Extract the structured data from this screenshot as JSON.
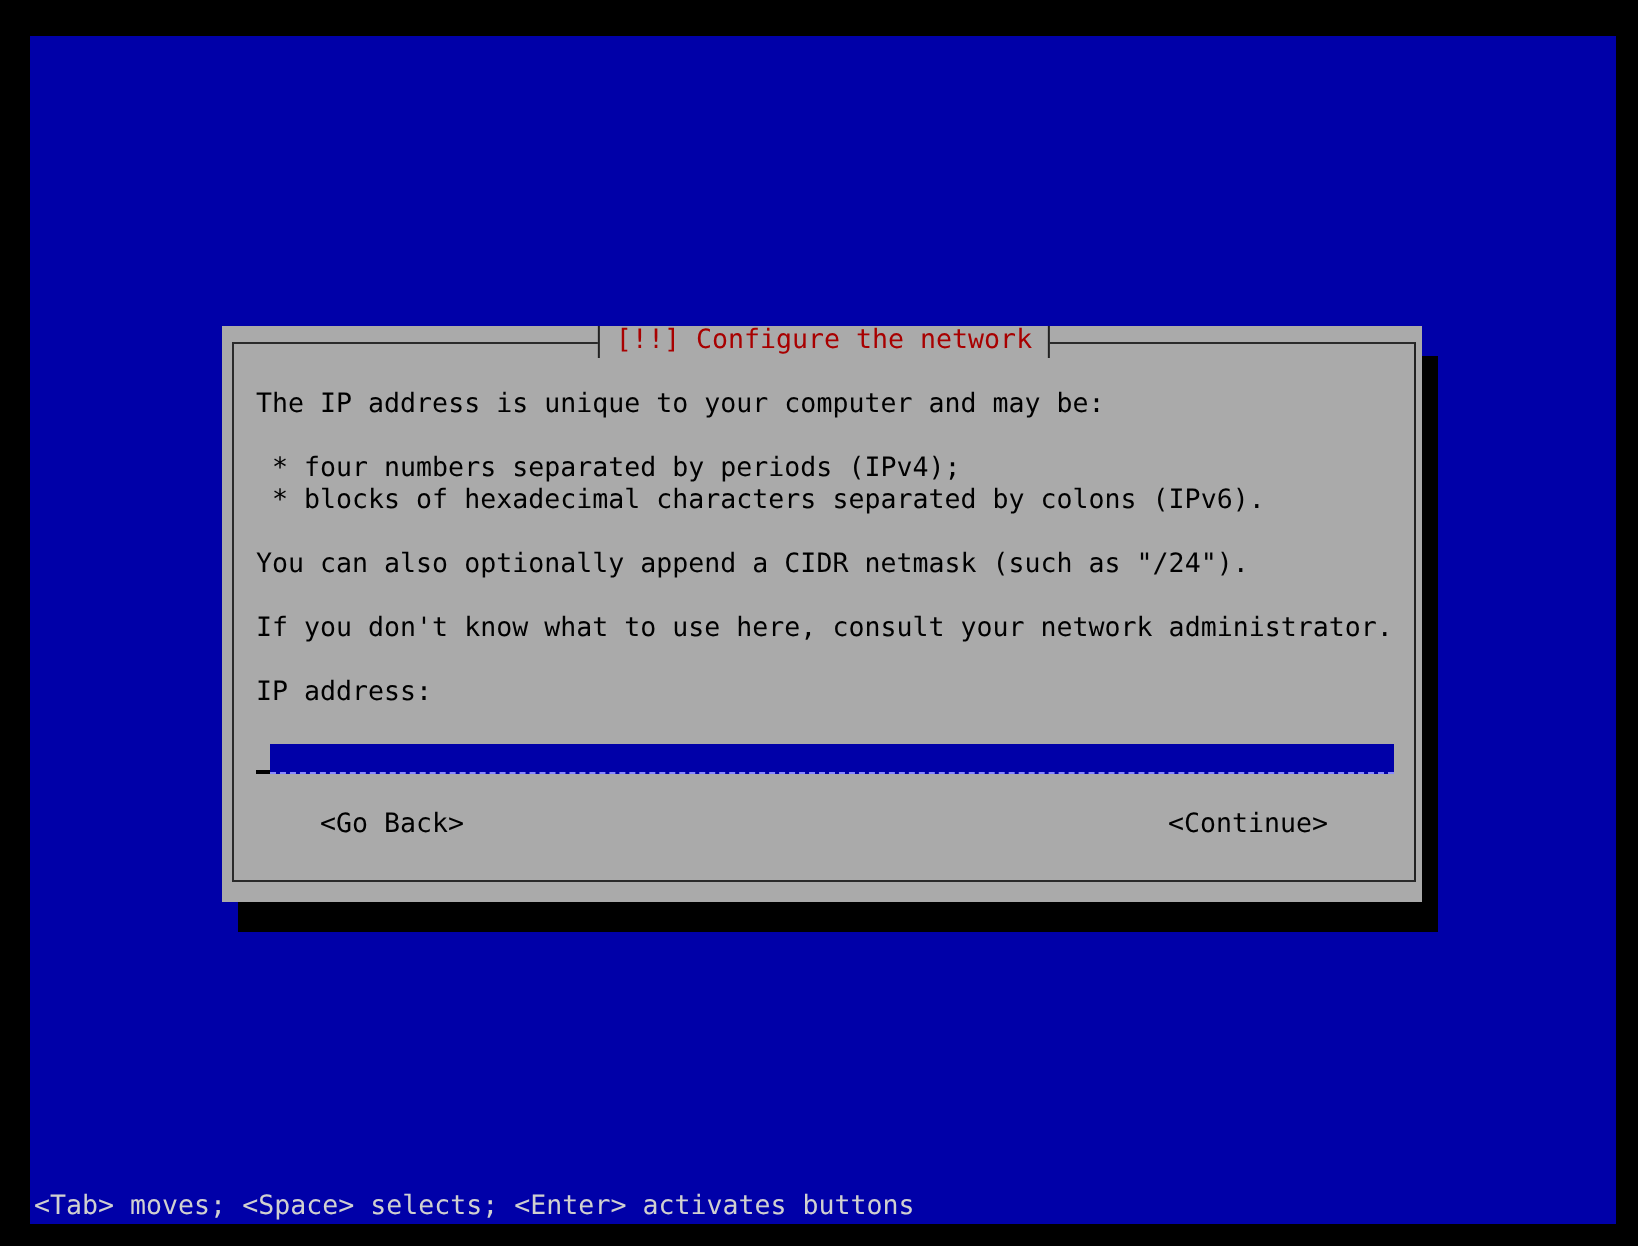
{
  "dialog": {
    "title": "[!!] Configure the network",
    "body": [
      {
        "kind": "paragraph",
        "text": "The IP address is unique to your computer and may be:"
      },
      {
        "kind": "bullets",
        "items": [
          "* four numbers separated by periods (IPv4);",
          "* blocks of hexadecimal characters separated by colons (IPv6)."
        ]
      },
      {
        "kind": "paragraph",
        "text": "You can also optionally append a CIDR netmask (such as \"/24\")."
      },
      {
        "kind": "paragraph",
        "text": "If you don't know what to use here, consult your network administrator."
      }
    ],
    "field": {
      "label": "IP address:",
      "focused": true
    },
    "buttons": [
      {
        "label": "<Go Back>",
        "selected": false
      },
      {
        "label": "<Continue>",
        "selected": false
      }
    ]
  },
  "status_bar": "<Tab> moves; <Space> selects; <Enter> activates buttons"
}
